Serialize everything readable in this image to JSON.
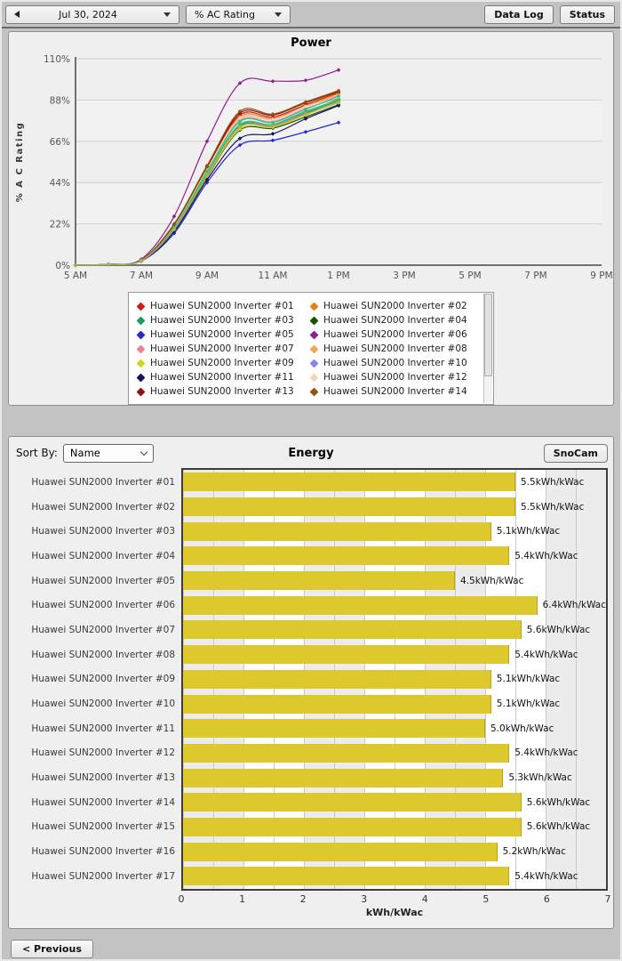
{
  "toolbar": {
    "date": "Jul 30, 2024",
    "metric": "% AC Rating",
    "data_log_label": "Data Log",
    "status_label": "Status"
  },
  "icons": {
    "previous_day_icon": "left-triangle",
    "dropdown_caret_icon": "down-triangle",
    "sort_select_chevron_icon": "chevron-down"
  },
  "power": {
    "title": "Power",
    "ylabel": "% A C Rating",
    "legend_visible_entries": 14
  },
  "energy": {
    "sort_by_label": "Sort By:",
    "sort_value": "Name",
    "title": "Energy",
    "snocam_label": "SnoCam",
    "xlabel": "kWh/kWac"
  },
  "footer": {
    "previous_label": "< Previous"
  },
  "chart_data": [
    {
      "type": "line",
      "title": "Power",
      "ylabel": "% A C Rating",
      "xlim_hours": [
        5,
        21
      ],
      "ylim": [
        0,
        110
      ],
      "grid": "horizontal",
      "legend_position": "bottom",
      "band_fill_intervals": [
        [
          22,
          44
        ],
        [
          66,
          88
        ]
      ],
      "xtick_hours": [
        5,
        7,
        9,
        11,
        13,
        15,
        17,
        19,
        21
      ],
      "xtick_labels": [
        "5 AM",
        "7 AM",
        "9 AM",
        "11 AM",
        "1 PM",
        "3 PM",
        "5 PM",
        "7 PM",
        "9 PM"
      ],
      "ytick_values": [
        0,
        22,
        44,
        66,
        88,
        110
      ],
      "ytick_labels": [
        "0%",
        "22%",
        "44%",
        "66%",
        "88%",
        "110%"
      ],
      "x_hours": [
        5,
        6,
        7,
        8,
        9,
        10,
        11,
        12,
        13
      ],
      "series": [
        {
          "name": "Huawei SUN2000 Inverter #01",
          "color": "#cf1d1d",
          "values": [
            0,
            0.4,
            2.6,
            21,
            52,
            80,
            79,
            85.5,
            92
          ]
        },
        {
          "name": "Huawei SUN2000 Inverter #02",
          "color": "#e87e14",
          "values": [
            0,
            0.4,
            2.6,
            21,
            51,
            79,
            78.2,
            85,
            91.5
          ]
        },
        {
          "name": "Huawei SUN2000 Inverter #03",
          "color": "#1f9e59",
          "values": [
            0,
            0.3,
            2.4,
            19,
            48,
            74,
            74,
            81,
            87.5
          ]
        },
        {
          "name": "Huawei SUN2000 Inverter #04",
          "color": "#1e4d00",
          "values": [
            0,
            0.3,
            2.3,
            19,
            47,
            72,
            73,
            79,
            85.5
          ]
        },
        {
          "name": "Huawei SUN2000 Inverter #05",
          "color": "#2727cc",
          "values": [
            0,
            0.3,
            2.2,
            17,
            44,
            64,
            66.5,
            71,
            76
          ]
        },
        {
          "name": "Huawei SUN2000 Inverter #06",
          "color": "#8e1d8e",
          "values": [
            0,
            0.5,
            3.2,
            26,
            66,
            97,
            98,
            98.5,
            104
          ]
        },
        {
          "name": "Huawei SUN2000 Inverter #07",
          "color": "#ef8090",
          "values": [
            0,
            0.4,
            2.5,
            20,
            50,
            77,
            76.5,
            83.5,
            89
          ]
        },
        {
          "name": "Huawei SUN2000 Inverter #08",
          "color": "#f3a556",
          "values": [
            0,
            0.4,
            2.5,
            20.5,
            50.5,
            78,
            77.5,
            84.5,
            90.5
          ]
        },
        {
          "name": "Huawei SUN2000 Inverter #09",
          "color": "#d3d31f",
          "values": [
            0,
            0.3,
            2.4,
            19,
            47.5,
            72.5,
            73.5,
            80,
            87
          ]
        },
        {
          "name": "Huawei SUN2000 Inverter #10",
          "color": "#8585ec",
          "values": [
            0,
            0.4,
            2.4,
            19.5,
            48.5,
            74.5,
            74.5,
            81.5,
            88.5
          ]
        },
        {
          "name": "Huawei SUN2000 Inverter #11",
          "color": "#15155e",
          "values": [
            0,
            0.3,
            2.3,
            18,
            45.5,
            67.5,
            70,
            78,
            85
          ]
        },
        {
          "name": "Huawei SUN2000 Inverter #12",
          "color": "#f7d4bf",
          "values": [
            0,
            0.4,
            2.5,
            20.5,
            51,
            78.5,
            77.5,
            84.5,
            89.5
          ]
        },
        {
          "name": "Huawei SUN2000 Inverter #13",
          "color": "#8f1111",
          "values": [
            0,
            0.4,
            2.7,
            21.5,
            52.5,
            81,
            80,
            86.5,
            92.5
          ]
        },
        {
          "name": "Huawei SUN2000 Inverter #14",
          "color": "#8f5a0f",
          "values": [
            0,
            0.4,
            2.7,
            22,
            53,
            82,
            80.5,
            87,
            93
          ]
        },
        {
          "name": "Huawei SUN2000 Inverter #15",
          "color": "#1fc8a8",
          "values": [
            0,
            0.4,
            2.5,
            20,
            50,
            76.5,
            76,
            83,
            90
          ]
        },
        {
          "name": "Huawei SUN2000 Inverter #16",
          "color": "#37c837",
          "values": [
            0,
            0.3,
            2.4,
            19.5,
            49,
            75,
            75,
            82,
            88
          ]
        },
        {
          "name": "Huawei SUN2000 Inverter #17",
          "color": "#b9aa55",
          "values": [
            0,
            0.3,
            2.4,
            19,
            48,
            73.5,
            74,
            80.5,
            86.5
          ]
        }
      ]
    },
    {
      "type": "bar",
      "orientation": "horizontal",
      "title": "Energy",
      "xlabel": "kWh/kWac",
      "xlim": [
        0,
        7
      ],
      "xticks": [
        "0",
        "1",
        "2",
        "3",
        "4",
        "5",
        "6",
        "7"
      ],
      "bar_color": "#ddc82d",
      "categories": [
        "Huawei SUN2000 Inverter #01",
        "Huawei SUN2000 Inverter #02",
        "Huawei SUN2000 Inverter #03",
        "Huawei SUN2000 Inverter #04",
        "Huawei SUN2000 Inverter #05",
        "Huawei SUN2000 Inverter #06",
        "Huawei SUN2000 Inverter #07",
        "Huawei SUN2000 Inverter #08",
        "Huawei SUN2000 Inverter #09",
        "Huawei SUN2000 Inverter #10",
        "Huawei SUN2000 Inverter #11",
        "Huawei SUN2000 Inverter #12",
        "Huawei SUN2000 Inverter #13",
        "Huawei SUN2000 Inverter #14",
        "Huawei SUN2000 Inverter #15",
        "Huawei SUN2000 Inverter #16",
        "Huawei SUN2000 Inverter #17"
      ],
      "values": [
        5.5,
        5.5,
        5.1,
        5.4,
        4.5,
        6.4,
        5.6,
        5.4,
        5.1,
        5.1,
        5.0,
        5.4,
        5.3,
        5.6,
        5.6,
        5.2,
        5.4
      ],
      "value_labels": [
        "5.5kWh/kWac",
        "5.5kWh/kWac",
        "5.1kWh/kWac",
        "5.4kWh/kWac",
        "4.5kWh/kWac",
        "6.4kWh/kWac",
        "5.6kWh/kWac",
        "5.4kWh/kWac",
        "5.1kWh/kWac",
        "5.1kWh/kWac",
        "5.0kWh/kWac",
        "5.4kWh/kWac",
        "5.3kWh/kWac",
        "5.6kWh/kWac",
        "5.6kWh/kWac",
        "5.2kWh/kWac",
        "5.4kWh/kWac"
      ]
    }
  ]
}
